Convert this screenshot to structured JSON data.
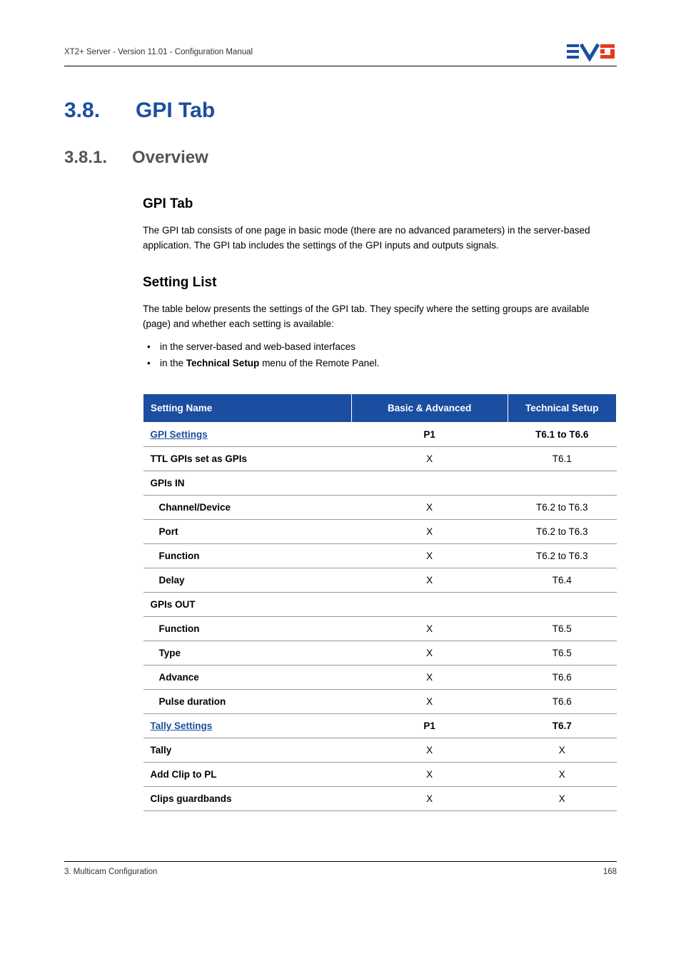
{
  "header": {
    "doc_title": "XT2+ Server - Version 11.01 - Configuration Manual"
  },
  "section": {
    "num": "3.8.",
    "title": "GPI Tab"
  },
  "subsection": {
    "num": "3.8.1.",
    "title": "Overview"
  },
  "gpi_tab": {
    "heading": "GPI Tab",
    "para": "The GPI tab consists of one page in basic mode (there are no advanced parameters) in the server-based application. The GPI tab includes the settings of the GPI inputs and outputs signals."
  },
  "setting_list": {
    "heading": "Setting List",
    "para": "The table below presents the settings of the GPI tab. They specify where the setting groups are available (page) and whether each setting is available:",
    "bullet1": "in the server-based and web-based interfaces",
    "bullet2_pre": "in the ",
    "bullet2_bold": "Technical  Setup",
    "bullet2_post": " menu of the Remote Panel."
  },
  "table": {
    "headers": {
      "c1": "Setting Name",
      "c2": "Basic & Advanced",
      "c3": "Technical Setup"
    },
    "rows": [
      {
        "name": "GPI Settings",
        "ba": "P1",
        "ts": "T6.1 to T6.6",
        "link": true,
        "bold_row": true,
        "indent": false
      },
      {
        "name": "TTL GPIs set as GPIs",
        "ba": "X",
        "ts": "T6.1",
        "link": false,
        "bold_row": false,
        "bold_name": true,
        "indent": false
      },
      {
        "name": "GPIs IN",
        "ba": "",
        "ts": "",
        "link": false,
        "bold_row": false,
        "bold_name": true,
        "indent": false
      },
      {
        "name": "Channel/Device",
        "ba": "X",
        "ts": "T6.2 to T6.3",
        "link": false,
        "bold_row": false,
        "bold_name": true,
        "indent": true
      },
      {
        "name": "Port",
        "ba": "X",
        "ts": "T6.2 to T6.3",
        "link": false,
        "bold_row": false,
        "bold_name": true,
        "indent": true
      },
      {
        "name": "Function",
        "ba": "X",
        "ts": "T6.2 to T6.3",
        "link": false,
        "bold_row": false,
        "bold_name": true,
        "indent": true
      },
      {
        "name": "Delay",
        "ba": "X",
        "ts": "T6.4",
        "link": false,
        "bold_row": false,
        "bold_name": true,
        "indent": true
      },
      {
        "name": "GPIs OUT",
        "ba": "",
        "ts": "",
        "link": false,
        "bold_row": false,
        "bold_name": true,
        "indent": false
      },
      {
        "name": "Function",
        "ba": "X",
        "ts": "T6.5",
        "link": false,
        "bold_row": false,
        "bold_name": true,
        "indent": true
      },
      {
        "name": "Type",
        "ba": "X",
        "ts": "T6.5",
        "link": false,
        "bold_row": false,
        "bold_name": true,
        "indent": true
      },
      {
        "name": "Advance",
        "ba": "X",
        "ts": "T6.6",
        "link": false,
        "bold_row": false,
        "bold_name": true,
        "indent": true
      },
      {
        "name": "Pulse duration",
        "ba": "X",
        "ts": "T6.6",
        "link": false,
        "bold_row": false,
        "bold_name": true,
        "indent": true
      },
      {
        "name": "Tally Settings",
        "ba": "P1",
        "ts": "T6.7",
        "link": true,
        "bold_row": true,
        "indent": false
      },
      {
        "name": "Tally",
        "ba": "X",
        "ts": "X",
        "link": false,
        "bold_row": false,
        "bold_name": true,
        "indent": false
      },
      {
        "name": "Add Clip to PL",
        "ba": "X",
        "ts": "X",
        "link": false,
        "bold_row": false,
        "bold_name": true,
        "indent": false
      },
      {
        "name": "Clips guardbands",
        "ba": "X",
        "ts": "X",
        "link": false,
        "bold_row": false,
        "bold_name": true,
        "indent": false
      }
    ]
  },
  "footer": {
    "left": "3. Multicam Configuration",
    "right": "168"
  }
}
